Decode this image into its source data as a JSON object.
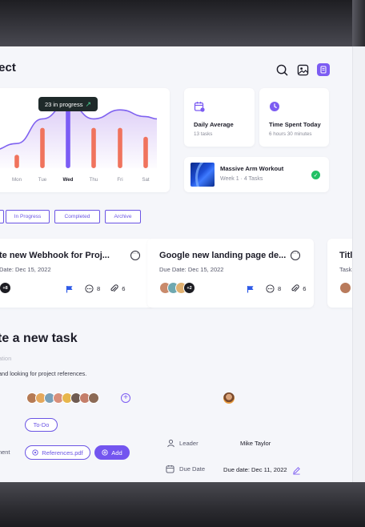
{
  "header": {
    "title": "ject",
    "icons": [
      "search-icon",
      "image-icon",
      "notes-icon"
    ]
  },
  "chart_data": {
    "type": "area",
    "categories": [
      "Mon",
      "Tue",
      "Wed",
      "Thu",
      "Fri",
      "Sat"
    ],
    "bar_values": [
      3,
      9,
      14,
      9,
      9,
      7
    ],
    "line_values": [
      5.5,
      11,
      14.5,
      11,
      13,
      11.5
    ],
    "highlight": "Wed",
    "tooltip": "23 in progress",
    "colors": {
      "bar": "#f0735d",
      "highlight_bar": "#7b5cf5",
      "line": "#7f62f0",
      "area": "#d9c8f6"
    }
  },
  "stats": [
    {
      "label": "Daily Average",
      "sub": "13 tasks",
      "icon": "calendar-icon"
    },
    {
      "label": "Time Spent Today",
      "sub": "6 hours 30 minutes",
      "icon": "clock-icon"
    }
  ],
  "workout": {
    "title": "Massive Arm Workout",
    "sub": "Week 1 · 4 Tasks"
  },
  "filters": [
    "In Progress",
    "Completed",
    "Archive"
  ],
  "tasks": [
    {
      "title": "te new Webhook for Proj...",
      "due": "Date: Dec 15, 2022",
      "more_count": "+8",
      "comments": "8",
      "attachments": "6"
    },
    {
      "title": "Google new landing page de...",
      "due": "Due Date: Dec 15, 2022",
      "more_count": "+2",
      "comments": "8",
      "attachments": "6"
    },
    {
      "title": "Titl",
      "due": "Task"
    }
  ],
  "new_task": {
    "title": "te a new task",
    "faint": "ation",
    "description": "and looking for project references.",
    "leader_label": "Leader",
    "leader_name": "Mike Taylor",
    "due_label": "Due Date",
    "due_value": "Due date: Dec 11, 2022",
    "status": "To-Do",
    "attachment_label": "ment",
    "attachment_file": "References.pdf",
    "add_label": "Add"
  },
  "accent": "#7355ef"
}
